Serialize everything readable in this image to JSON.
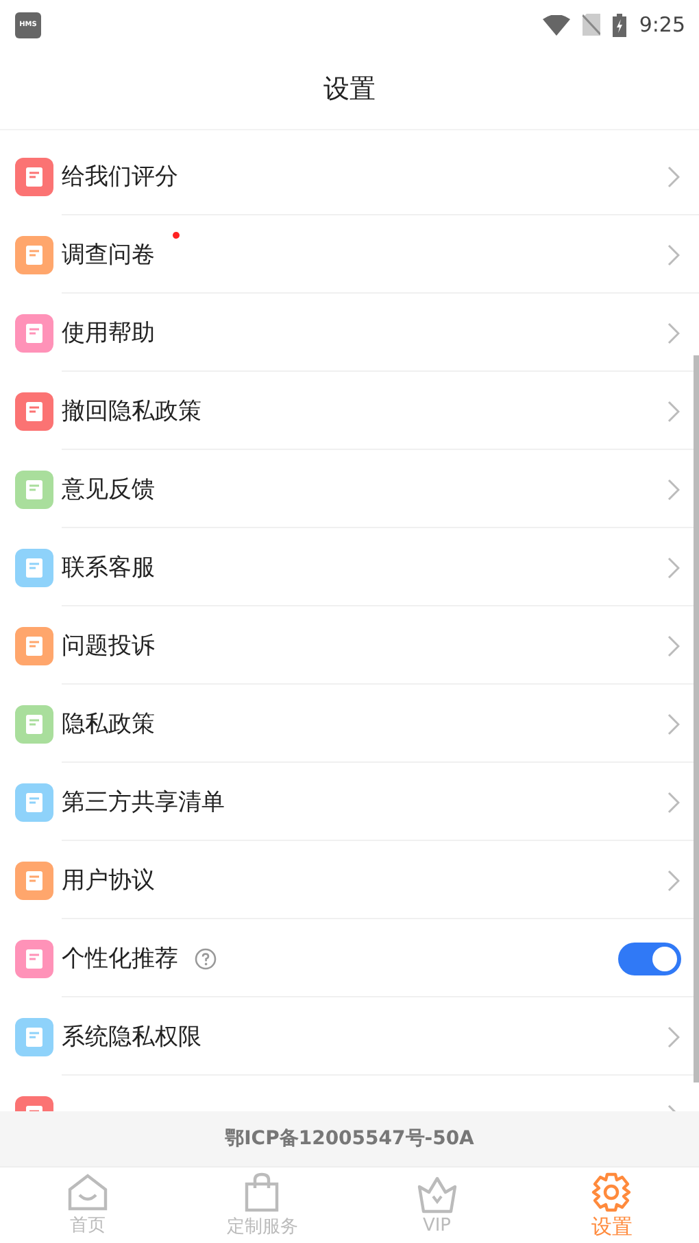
{
  "status_bar": {
    "app_badge": "HMS",
    "time": "9:25"
  },
  "header": {
    "title": "设置"
  },
  "items": [
    {
      "label": "给我们评分",
      "kind": "link",
      "color": "#fb7373",
      "badge": false,
      "help": false
    },
    {
      "label": "调查问卷",
      "kind": "link",
      "color": "#ffa66c",
      "badge": true,
      "help": false
    },
    {
      "label": "使用帮助",
      "kind": "link",
      "color": "#ff92b8",
      "badge": false,
      "help": false
    },
    {
      "label": "撤回隐私政策",
      "kind": "link",
      "color": "#fb7373",
      "badge": false,
      "help": false
    },
    {
      "label": "意见反馈",
      "kind": "link",
      "color": "#a9de9c",
      "badge": false,
      "help": false
    },
    {
      "label": "联系客服",
      "kind": "link",
      "color": "#8ed2fa",
      "badge": false,
      "help": false
    },
    {
      "label": "问题投诉",
      "kind": "link",
      "color": "#ffa66c",
      "badge": false,
      "help": false
    },
    {
      "label": "隐私政策",
      "kind": "link",
      "color": "#a9de9c",
      "badge": false,
      "help": false
    },
    {
      "label": "第三方共享清单",
      "kind": "link",
      "color": "#8ed2fa",
      "badge": false,
      "help": false
    },
    {
      "label": "用户协议",
      "kind": "link",
      "color": "#ffa66c",
      "badge": false,
      "help": false
    },
    {
      "label": "个性化推荐",
      "kind": "toggle",
      "on": true,
      "color": "#ff92b8",
      "badge": false,
      "help": true
    },
    {
      "label": "系统隐私权限",
      "kind": "link",
      "color": "#8ed2fa",
      "badge": false,
      "help": false
    },
    {
      "kind": "link",
      "color": "#fb7373"
    }
  ],
  "footer_note": "鄂ICP备12005547号-50A",
  "tabs": [
    {
      "label": "首页",
      "kind": "home",
      "selected": false
    },
    {
      "label": "定制服务",
      "kind": "bag",
      "selected": false
    },
    {
      "label": "VIP",
      "kind": "crown",
      "selected": false
    },
    {
      "label": "设置",
      "kind": "gear",
      "selected": true
    }
  ]
}
